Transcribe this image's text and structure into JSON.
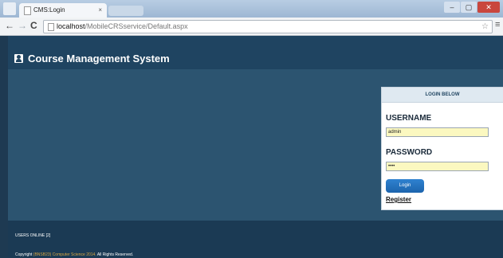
{
  "browser": {
    "tab_title": "CMS:Login",
    "tab_close": "×",
    "url_host": "localhost",
    "url_path": "/MobileCRSservice/Default.aspx",
    "back_glyph": "←",
    "forward_glyph": "→",
    "reload_glyph": "C",
    "star_glyph": "☆",
    "menu_glyph": "≡",
    "minimize_glyph": "–",
    "maximize_glyph": "▢",
    "close_glyph": "✕"
  },
  "header": {
    "title": "Course Management System",
    "icon": "user-icon"
  },
  "login": {
    "panel_title": "LOGIN BELOW",
    "username_label": "USERNAME",
    "username_value": "admin",
    "password_label": "PASSWORD",
    "password_value": "••••",
    "login_button": "Login",
    "register_link": "Register"
  },
  "footer": {
    "users_online": "USERS ONLINE [2]",
    "copyright_prefix": "Copyright ",
    "copyright_org": "(BNSB23) Computer Science 2014.",
    "copyright_suffix": " All Rights Reserved."
  },
  "colors": {
    "header_bg": "#1f4461",
    "main_bg": "#2c5470",
    "footer_bg": "#1b3a54",
    "button_blue": "#1c64ad",
    "input_bg": "#fbf8c0"
  }
}
